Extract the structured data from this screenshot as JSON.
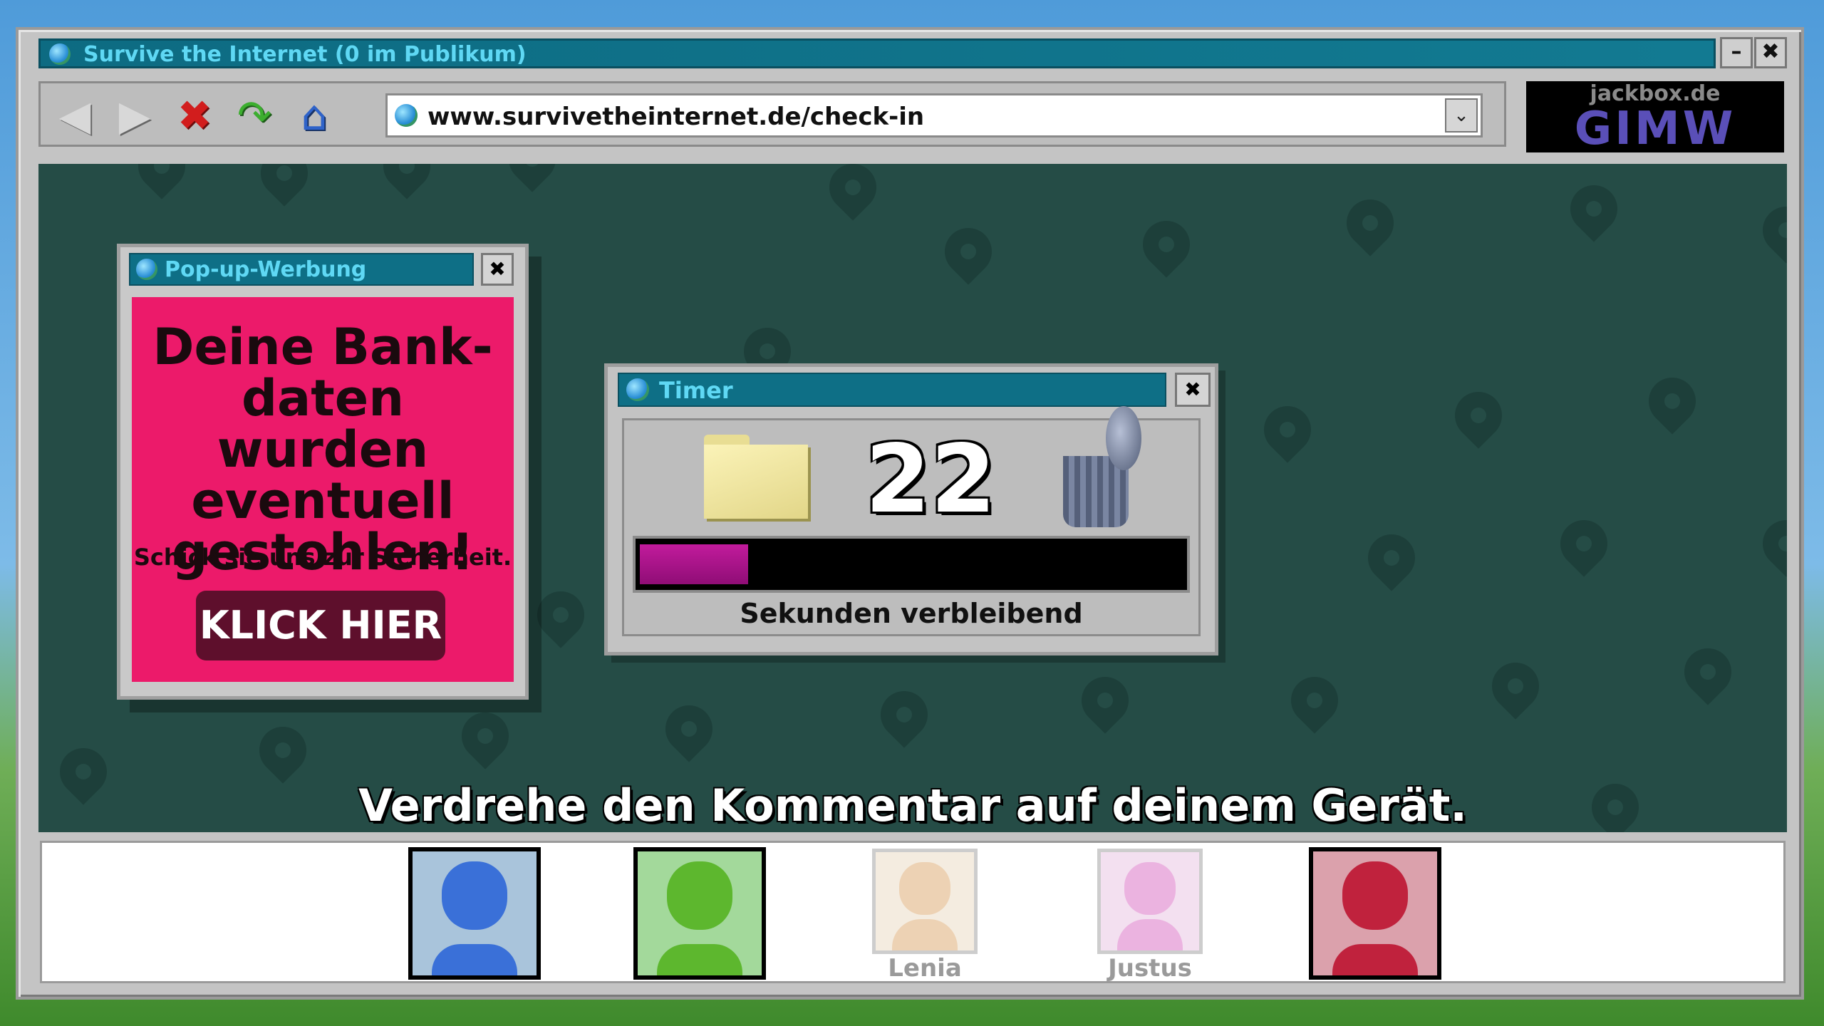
{
  "window": {
    "title": "Survive the Internet  (0 im Publikum)",
    "minimize_label": "–",
    "close_label": "✖"
  },
  "toolbar": {
    "back_icon": "back-arrow-icon",
    "forward_icon": "forward-arrow-icon",
    "stop_icon": "stop-x-icon",
    "refresh_icon": "refresh-arrow-icon",
    "home_icon": "home-icon",
    "back_glyph": "◀",
    "forward_glyph": "▶",
    "stop_glyph": "✖",
    "refresh_glyph": "↷",
    "home_glyph": "⌂"
  },
  "address_bar": {
    "url": "www.survivetheinternet.de/check-in",
    "dropdown_glyph": "⌄"
  },
  "brand": {
    "site": "jackbox.de",
    "code": "GIMW"
  },
  "popup": {
    "title": "Pop-up-Werbung",
    "close_label": "✖",
    "headline": "Deine Bank-daten wurden eventuell gestohlen!",
    "subtext": "Schick sie uns zur Sicherheit.",
    "cta": "KLICK HIER",
    "background_color": "#ec1a6a"
  },
  "timer": {
    "title": "Timer",
    "close_label": "✖",
    "seconds": "22",
    "caption": "Sekunden verbleibend",
    "progress_fraction": 0.2,
    "bar_color": "#c21b9c"
  },
  "instruction": "Verdrehe den Kommentar auf deinem Gerät.",
  "players": [
    {
      "name": "",
      "color": "#3a70d8",
      "bg": "#a9c4db",
      "state": "active"
    },
    {
      "name": "",
      "color": "#5db72e",
      "bg": "#a3d99b",
      "state": "active"
    },
    {
      "name": "Lenia",
      "color": "#e7c49b",
      "bg": "#f1e6d6",
      "state": "empty"
    },
    {
      "name": "Justus",
      "color": "#e59ad6",
      "bg": "#f0d6ec",
      "state": "empty"
    },
    {
      "name": "",
      "color": "#c0223d",
      "bg": "#dba1ac",
      "state": "active"
    }
  ]
}
